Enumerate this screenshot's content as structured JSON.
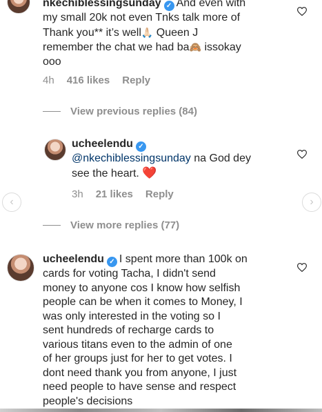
{
  "comment1": {
    "username": "nkechiblessingsunday",
    "text_line1": "And even with",
    "text_line2": "my small 20k not even Tnks talk more of",
    "text_line3a": "Thank you** it’s well",
    "emoji1": "🙏🏻",
    "text_line3b": "Queen J",
    "text_line4a": "remember the chat we had ba",
    "emoji2": "🙈",
    "text_line4b": "issokay",
    "text_line5": "ooo",
    "time": "4h",
    "likes": "416 likes",
    "reply": "Reply"
  },
  "view_previous": "View previous replies (84)",
  "reply1": {
    "username": "ucheelendu",
    "mention": "@nkechiblessingsunday",
    "text_a": "na God dey",
    "text_b": "see the heart.",
    "emoji": "❤️",
    "time": "3h",
    "likes": "21 likes",
    "reply": "Reply"
  },
  "view_more": "View more replies (77)",
  "comment2": {
    "username": "ucheelendu",
    "lines": [
      "I spent more than 100k on",
      "cards for voting Tacha, I didn't send",
      "money to anyone cos I know how selfish",
      "people can be when it comes to Money, I",
      "was only interested in the voting so I",
      "sent hundreds of recharge cards to",
      "various titans even to the admin of one",
      "of her groups just for her to get votes. I",
      "dont need thank you from anyone, I just",
      "need people to have sense and respect",
      "people's decisions"
    ]
  },
  "icons": {
    "verified": "verified-badge-icon",
    "heart": "heart-outline-icon",
    "prev": "chevron-left-icon",
    "next": "chevron-right-icon"
  },
  "colors": {
    "accent": "#3897f0",
    "muted": "#8e8e8e",
    "mention": "#003569"
  }
}
